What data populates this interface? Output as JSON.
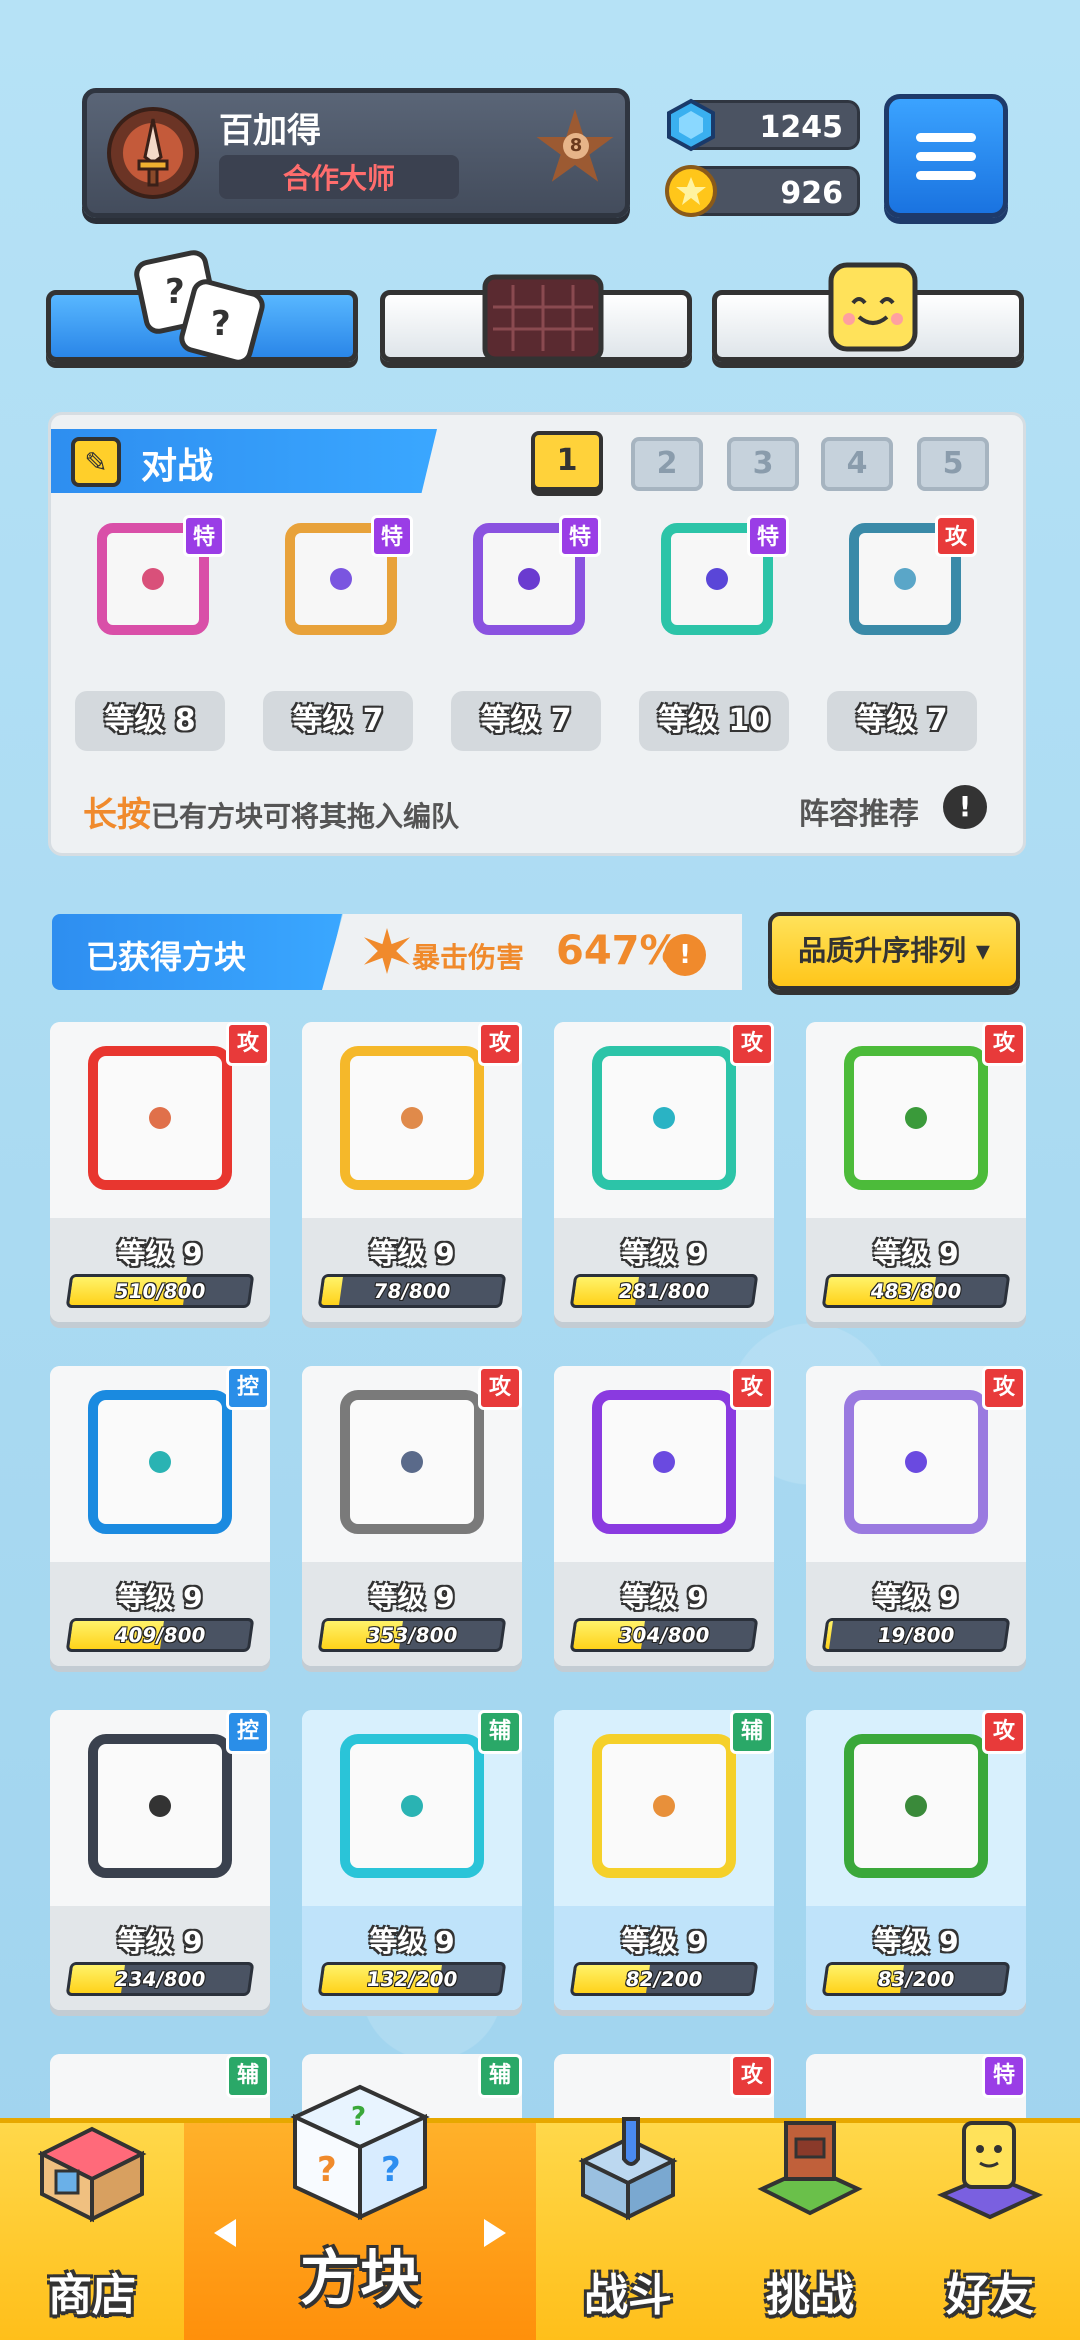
{
  "player": {
    "name": "百加得",
    "title": "合作大师",
    "rank": "8"
  },
  "currency": {
    "gems": "1245",
    "coins": "926"
  },
  "battle": {
    "title": "对战",
    "deck_tabs": [
      "1",
      "2",
      "3",
      "4",
      "5"
    ],
    "active_deck": 0,
    "dice": [
      {
        "tag": "特",
        "tag_type": "te",
        "level": "等级 8",
        "color": "#d94fa8",
        "pip": "#d9507a"
      },
      {
        "tag": "特",
        "tag_type": "te",
        "level": "等级 7",
        "color": "#e8a23a",
        "pip": "#7a55e0"
      },
      {
        "tag": "特",
        "tag_type": "te",
        "level": "等级 7",
        "color": "#8a52e0",
        "pip": "#6a3bd0"
      },
      {
        "tag": "特",
        "tag_type": "te",
        "level": "等级 10",
        "color": "#2cc4a8",
        "pip": "#5a46d8"
      },
      {
        "tag": "攻",
        "tag_type": "gong",
        "level": "等级 7",
        "color": "#3a8aa8",
        "pip": "#5aa6c8"
      }
    ],
    "hint_accent": "长按",
    "hint_rest": "已有方块可将其拖入编队",
    "lineup": "阵容推荐",
    "info_icon": "!"
  },
  "obtained": {
    "title": "已获得方块",
    "crit_label": "暴击伤害",
    "crit_value": "647%",
    "crit_info": "!",
    "sort_label": "品质升序排列 ▾"
  },
  "cards": [
    {
      "tag": "攻",
      "tag_type": "gong",
      "level": "等级 9",
      "progress": "510/800",
      "fill": 0.64,
      "border": "#e8362f",
      "pip": "#e0704a",
      "owned": false
    },
    {
      "tag": "攻",
      "tag_type": "gong",
      "level": "等级 9",
      "progress": "78/800",
      "fill": 0.1,
      "border": "#f5b82a",
      "pip": "#e08a4a",
      "owned": false
    },
    {
      "tag": "攻",
      "tag_type": "gong",
      "level": "等级 9",
      "progress": "281/800",
      "fill": 0.35,
      "border": "#2cc4a8",
      "pip": "#2ab3c4",
      "owned": false
    },
    {
      "tag": "攻",
      "tag_type": "gong",
      "level": "等级 9",
      "progress": "483/800",
      "fill": 0.6,
      "border": "#4cbb3a",
      "pip": "#3a9a3a",
      "owned": false
    },
    {
      "tag": "控",
      "tag_type": "kong",
      "level": "等级 9",
      "progress": "409/800",
      "fill": 0.51,
      "border": "#1a8ae0",
      "pip": "#2ab3b3",
      "owned": false
    },
    {
      "tag": "攻",
      "tag_type": "gong",
      "level": "等级 9",
      "progress": "353/800",
      "fill": 0.44,
      "border": "#7a7a7a",
      "pip": "#5a6a8a",
      "owned": false
    },
    {
      "tag": "攻",
      "tag_type": "gong",
      "level": "等级 9",
      "progress": "304/800",
      "fill": 0.38,
      "border": "#8a3ae0",
      "pip": "#6a4ae0",
      "owned": false
    },
    {
      "tag": "攻",
      "tag_type": "gong",
      "level": "等级 9",
      "progress": "19/800",
      "fill": 0.02,
      "border": "#9a7ae0",
      "pip": "#6a4ae0",
      "owned": false
    },
    {
      "tag": "控",
      "tag_type": "kong",
      "level": "等级 9",
      "progress": "234/800",
      "fill": 0.29,
      "border": "#3a414e",
      "pip": "#333333",
      "owned": false
    },
    {
      "tag": "辅",
      "tag_type": "fu",
      "level": "等级 9",
      "progress": "132/200",
      "fill": 0.66,
      "border": "#2ac4d8",
      "pip": "#2ab3b3",
      "owned": true
    },
    {
      "tag": "辅",
      "tag_type": "fu",
      "level": "等级 9",
      "progress": "82/200",
      "fill": 0.41,
      "border": "#f5d02a",
      "pip": "#e8903a",
      "owned": true
    },
    {
      "tag": "攻",
      "tag_type": "gong",
      "level": "等级 9",
      "progress": "83/200",
      "fill": 0.42,
      "border": "#3aa83a",
      "pip": "#3a8a3a",
      "owned": true
    }
  ],
  "peek_tags": [
    {
      "tag": "辅",
      "tag_type": "fu"
    },
    {
      "tag": "辅",
      "tag_type": "fu"
    },
    {
      "tag": "攻",
      "tag_type": "gong"
    },
    {
      "tag": "特",
      "tag_type": "te"
    }
  ],
  "nav": {
    "shop": "商店",
    "dice": "方块",
    "battle": "战斗",
    "challenge": "挑战",
    "friends": "好友"
  },
  "colors": {
    "accent_blue": "#2e8ef0",
    "accent_yellow": "#ffd23a",
    "accent_orange": "#f08a2c"
  }
}
